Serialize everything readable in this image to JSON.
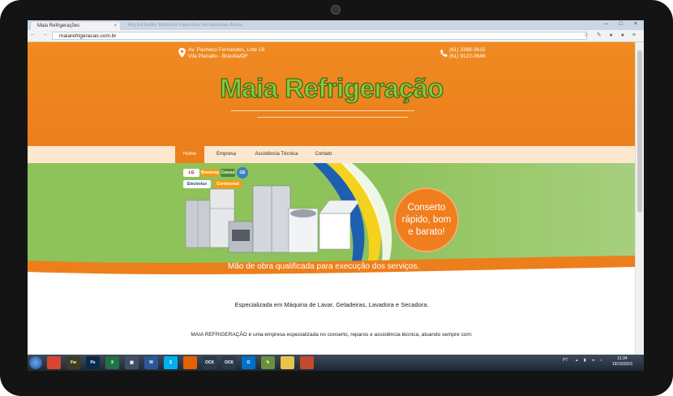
{
  "browser": {
    "tab_title": "Maia Refrigerações",
    "tab_close": "×",
    "menu_ghost": "Arq  Ed  Exibir  Histórico  Favoritos  Ferramentas  Ajuda",
    "window_buttons": "– □ ×",
    "url": "maiarefrigeracao.com.br",
    "nav_icons": "← → C",
    "ext_icons": "☆ ✎ ● ● ≡"
  },
  "site": {
    "address_line1": "Av. Pacheco Fernandes, Lote 18",
    "address_line2": "Vila Planalto - Brasília/DF",
    "phone_line1": "(61) 3386-3615",
    "phone_line2": "(61) 9122-0646",
    "logo": "Maia Refrigeração",
    "nav": [
      "Home",
      "Empresa",
      "Assistência Técnica",
      "Contato"
    ],
    "brands": [
      "LG",
      "Brastemp",
      "Consul",
      "GE",
      "Electrolux",
      "Continental"
    ],
    "promo_lines": [
      "Conserto",
      "rápido, bom",
      "e barato!"
    ],
    "tagline": "Mão de obra qualificada para execução dos serviços.",
    "specialty": "Especializada em Máquina de Lavar, Geladeiras, Lavadora e Secadora.",
    "about": "MAIA REFRIGERAÇÃO é uma empresa especializada no conserto, reparos e assistência técnica, atuando sempre com:"
  },
  "taskbar": {
    "apps": [
      {
        "name": "chrome",
        "label": "",
        "color": "#d9462f"
      },
      {
        "name": "fireworks",
        "label": "Fw",
        "color": "#3d3d1f"
      },
      {
        "name": "photoshop",
        "label": "Ps",
        "color": "#0b2a4a"
      },
      {
        "name": "excel",
        "label": "X",
        "color": "#1f7244"
      },
      {
        "name": "calculator",
        "label": "▦",
        "color": "#405064"
      },
      {
        "name": "word",
        "label": "W",
        "color": "#2b579a"
      },
      {
        "name": "skype",
        "label": "S",
        "color": "#00aff0"
      },
      {
        "name": "firefox",
        "label": "",
        "color": "#e66000"
      },
      {
        "name": "app-ock-1",
        "label": "OCK",
        "color": "#2a3b4c"
      },
      {
        "name": "app-ock-2",
        "label": "OCK",
        "color": "#2a3b4c"
      },
      {
        "name": "outlook",
        "label": "O",
        "color": "#0072c6"
      },
      {
        "name": "notepad",
        "label": "✎",
        "color": "#6a8f3f"
      },
      {
        "name": "explorer",
        "label": "",
        "color": "#e8c34a"
      },
      {
        "name": "paint",
        "label": "",
        "color": "#c44a2d"
      }
    ],
    "lang": "PT",
    "clock_time": "11:34",
    "clock_date": "19/10/2015"
  }
}
